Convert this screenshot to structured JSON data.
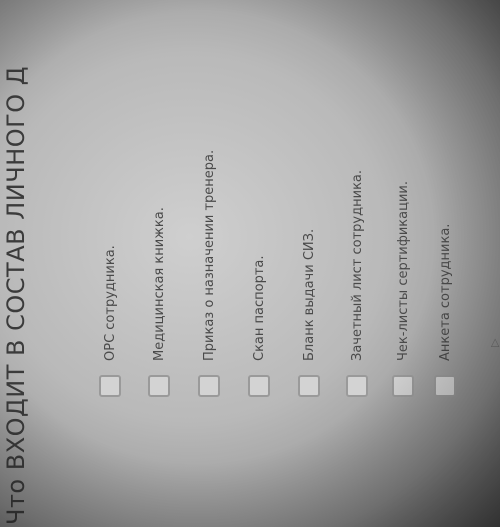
{
  "question": {
    "text": "Что ВХОДИТ В СОСТАВ ЛИЧНОГО Д"
  },
  "options": [
    {
      "label": "ОРС сотрудника.",
      "checked": false
    },
    {
      "label": "Медицинская книжка.",
      "checked": false
    },
    {
      "label": "Приказ о назначении тренера.",
      "checked": false
    },
    {
      "label": "Скан паспорта.",
      "checked": false
    },
    {
      "label": "Бланк выдачи СИЗ.",
      "checked": false
    },
    {
      "label": "Зачетный лист сотрудника.",
      "checked": false
    },
    {
      "label": "Чек-листы сертификации.",
      "checked": false
    },
    {
      "label": "Анкета сотрудника.",
      "checked": false
    }
  ]
}
